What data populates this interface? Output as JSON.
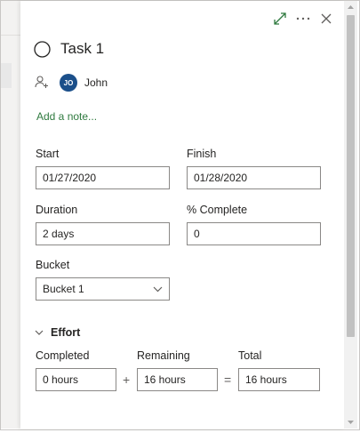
{
  "task": {
    "title": "Task 1",
    "assignee_initials": "JO",
    "assignee_name": "John",
    "add_note": "Add a note..."
  },
  "fields": {
    "start_label": "Start",
    "start_value": "01/27/2020",
    "finish_label": "Finish",
    "finish_value": "01/28/2020",
    "duration_label": "Duration",
    "duration_value": "2 days",
    "complete_label": "% Complete",
    "complete_value": "0",
    "bucket_label": "Bucket",
    "bucket_value": "Bucket 1"
  },
  "effort": {
    "section_label": "Effort",
    "completed_label": "Completed",
    "completed_value": "0 hours",
    "plus": "+",
    "remaining_label": "Remaining",
    "remaining_value": "16 hours",
    "equals": "=",
    "total_label": "Total",
    "total_value": "16 hours"
  },
  "icons": {
    "expand": "expand-icon",
    "more": "more-icon",
    "close": "close-icon"
  },
  "colors": {
    "accent_green": "#2f7a3f",
    "avatar_blue": "#1b4f8a"
  }
}
